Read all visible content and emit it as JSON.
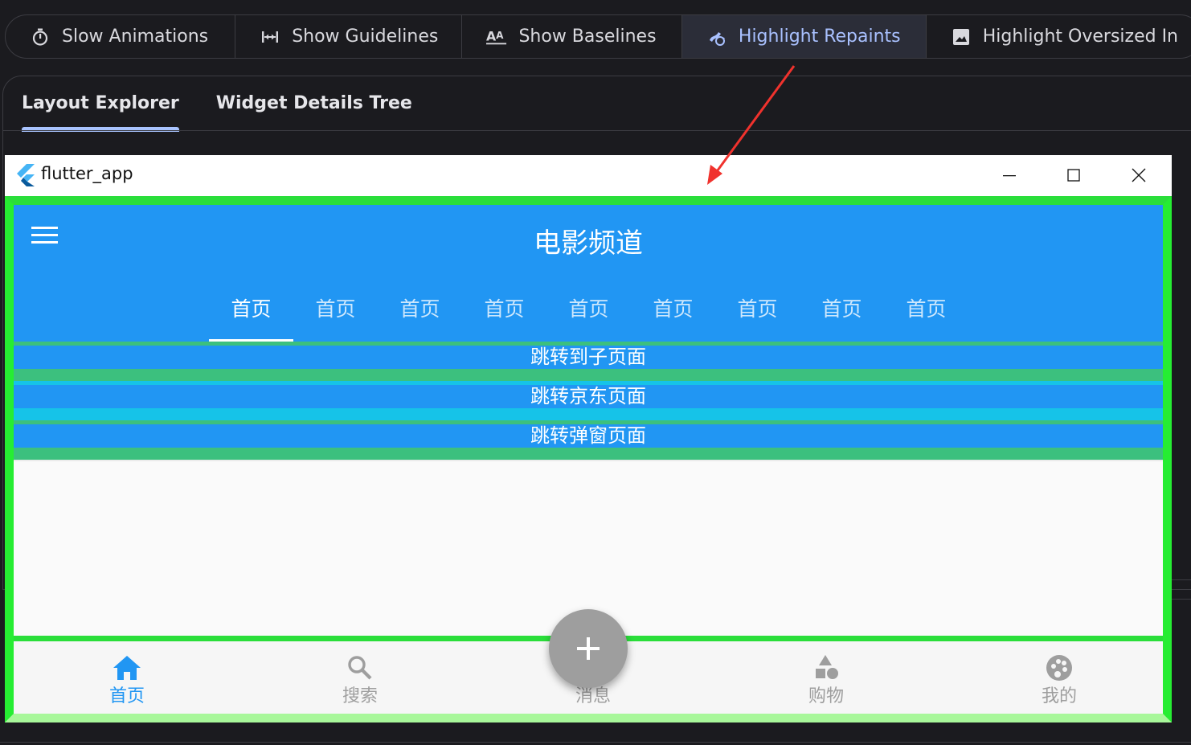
{
  "devtools": {
    "toolbar": [
      {
        "label": "Slow Animations",
        "icon": "timer-icon",
        "active": false
      },
      {
        "label": "Show Guidelines",
        "icon": "guidelines-icon",
        "active": false
      },
      {
        "label": "Show Baselines",
        "icon": "baselines-icon",
        "active": false
      },
      {
        "label": "Highlight Repaints",
        "icon": "repaint-icon",
        "active": true
      },
      {
        "label": "Highlight Oversized In",
        "icon": "image-icon",
        "active": false
      }
    ],
    "tabs": [
      {
        "label": "Layout Explorer",
        "active": true
      },
      {
        "label": "Widget Details Tree",
        "active": false
      }
    ]
  },
  "window": {
    "title": "flutter_app",
    "controls": [
      "minimize-icon",
      "maximize-icon",
      "close-icon"
    ]
  },
  "app": {
    "title": "电影频道",
    "tabs": [
      "首页",
      "首页",
      "首页",
      "首页",
      "首页",
      "首页",
      "首页",
      "首页",
      "首页"
    ],
    "active_tab": 0,
    "buttons": [
      "跳转到子页面",
      "跳转京东页面",
      "跳转弹窗页面"
    ],
    "bottom_nav": [
      {
        "label": "首页",
        "icon": "home-icon",
        "active": true
      },
      {
        "label": "搜索",
        "icon": "search-icon",
        "active": false
      },
      {
        "label": "消息",
        "icon": "add-icon",
        "active": false
      },
      {
        "label": "购物",
        "icon": "category-icon",
        "active": false
      },
      {
        "label": "我的",
        "icon": "palette-icon",
        "active": false
      }
    ],
    "fab_icon": "add-icon"
  },
  "colors": {
    "primary": "#2196f3",
    "repaint_highlight": "#26ed32",
    "devtools_bg": "#1b1b1f",
    "devtools_accent": "#a9c1ff",
    "fab": "#9e9e9e",
    "annotation_arrow": "#f0322d"
  }
}
